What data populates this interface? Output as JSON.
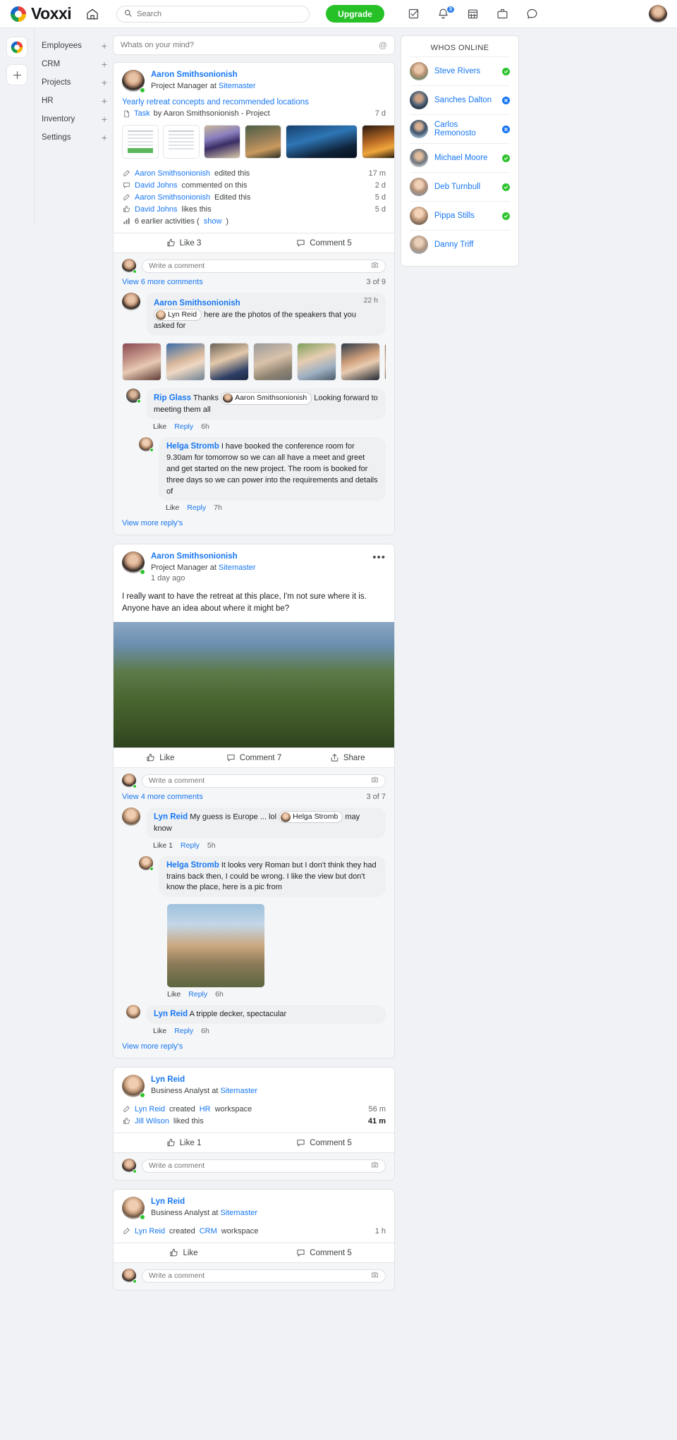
{
  "topbar": {
    "brand": "Voxxi",
    "home_icon": "home-icon",
    "search_placeholder": "Search",
    "upgrade_label": "Upgrade",
    "icons": [
      {
        "name": "tasks-icon",
        "glyph": "checkbox"
      },
      {
        "name": "notifications-icon",
        "glyph": "bell",
        "badge": "3"
      },
      {
        "name": "calendar-icon",
        "glyph": "calendar"
      },
      {
        "name": "briefcase-icon",
        "glyph": "briefcase"
      },
      {
        "name": "messages-icon",
        "glyph": "chat"
      }
    ],
    "accent_green": "#25c127",
    "accent_blue": "#1877f2"
  },
  "sidebar": {
    "workspace_icon": "voxxi-workspace-icon",
    "add_workspace_label": "+",
    "items": [
      {
        "label": "Employees",
        "add": "+"
      },
      {
        "label": "CRM",
        "add": "+"
      },
      {
        "label": "Projects",
        "add": "+"
      },
      {
        "label": "HR",
        "add": "+"
      },
      {
        "label": "Inventory",
        "add": "+"
      },
      {
        "label": "Settings",
        "add": "+"
      }
    ]
  },
  "composer": {
    "placeholder": "Whats on your mind?",
    "at_symbol": "@"
  },
  "posts": [
    {
      "author": "Aaron Smithsonionish",
      "role_prefix": "Project Manager at ",
      "company": "Sitemaster",
      "title": "Yearly retreat concepts and recommended locations",
      "task_prefix": "Task",
      "task_by": "by Aaron Smithsonionish - Project",
      "task_time": "7 d",
      "attachments": [
        {
          "name": "document-thumbnail-1",
          "kind": "doc-green"
        },
        {
          "name": "document-thumbnail-2",
          "kind": "doc"
        },
        {
          "name": "photo-cat-mask",
          "kind": "img-cat"
        },
        {
          "name": "photo-elephant",
          "kind": "img-eleph"
        },
        {
          "name": "photo-lake-night",
          "kind": "img-lake"
        },
        {
          "name": "photo-city-lights",
          "kind": "img-city"
        }
      ],
      "activities": [
        {
          "icon": "edit-icon",
          "actor": "Aaron Smithsonionish",
          "text": " edited this",
          "time": "17 m"
        },
        {
          "icon": "comment-icon",
          "actor": "David Johns",
          "text": " commented on this",
          "time": "2 d"
        },
        {
          "icon": "edit-icon",
          "actor": "Aaron Smithsonionish",
          "text": " Edited this",
          "time": "5 d"
        },
        {
          "icon": "thumbsup-icon",
          "actor": "David Johns",
          "text": " likes this",
          "time": "5 d"
        }
      ],
      "earlier": {
        "icon": "chart-icon",
        "text": "6 earlier activities (",
        "link": "show",
        "close": ")"
      },
      "bar": {
        "like": "Like 3",
        "comment": "Comment 5"
      },
      "comment_placeholder": "Write a comment",
      "view_more": "View 6 more comments",
      "count": "3 of 9",
      "comments": [
        {
          "author": "Aaron Smithsonionish",
          "mention": "Lyn Reid",
          "text": " here are the photos of the speakers that you asked for",
          "time": "22 h",
          "speakers": [
            "speaker-photo-1",
            "speaker-photo-2",
            "speaker-photo-3",
            "speaker-photo-4",
            "speaker-photo-5",
            "speaker-photo-6",
            "speaker-photo-7"
          ]
        },
        {
          "author": "Rip Glass",
          "text_before": " Thanks ",
          "mention": "Aaron Smithsonionish",
          "text_after": " Looking forward to meeting them all",
          "like": "Like",
          "reply": "Reply",
          "time": "6h"
        },
        {
          "author": "Helga Stromb",
          "text": " I have booked the conference room for 9.30am for tomorrow so we can all have a meet and greet and get started on the new project. The room is booked for three days so we can power into the requirements and details of",
          "like": "Like",
          "reply": "Reply",
          "time": "7h"
        }
      ],
      "view_more_replies": "View more reply's"
    },
    {
      "author": "Aaron Smithsonionish",
      "role_prefix": "Project Manager at ",
      "company": "Sitemaster",
      "time": "1 day ago",
      "menu": "•••",
      "body": "I really want to have the retreat at this place, I'm not sure where it is. Anyone have an idea about where it might be?",
      "hero_image": "photo-glenfinnan-valley",
      "bar": {
        "like": "Like",
        "comment": "Comment 7",
        "share": "Share"
      },
      "comment_placeholder": "Write a comment",
      "view_more": "View 4 more comments",
      "count": "3 of 7",
      "comments": [
        {
          "author": "Lyn Reid",
          "text_before": " My guess is Europe ... lol ",
          "mention": "Helga Stromb",
          "text_after": " may know",
          "like": "Like 1",
          "reply": "Reply",
          "time": "5h"
        },
        {
          "author": "Helga Stromb",
          "text": " It looks very Roman but I don't think they had trains back then, I could be wrong. I like the view but don't know the place, here is a pic from",
          "image": "photo-roman-aqueduct",
          "like": "Like",
          "reply": "Reply",
          "time": "6h"
        },
        {
          "author": "Lyn Reid",
          "text": " A tripple decker, spectacular",
          "like": "Like",
          "reply": "Reply",
          "time": "6h"
        }
      ],
      "view_more_replies": "View more reply's"
    },
    {
      "author": "Lyn Reid",
      "role_prefix": "Business Analyst at ",
      "company": "Sitemaster",
      "activities": [
        {
          "icon": "edit-icon",
          "actor": "Lyn Reid",
          "text_mid": " created ",
          "workspace": "HR",
          "text_end": " workspace",
          "time": "56 m"
        },
        {
          "icon": "thumbsup-icon",
          "actor": "Jill Wilson",
          "text": " liked this",
          "time": "41 m",
          "bold_time": true
        }
      ],
      "bar": {
        "like": "Like 1",
        "comment": "Comment 5"
      },
      "comment_placeholder": "Write a comment"
    },
    {
      "author": "Lyn Reid",
      "role_prefix": "Business Analyst at ",
      "company": "Sitemaster",
      "activities": [
        {
          "icon": "edit-icon",
          "actor": "Lyn Reid",
          "text_mid": " created ",
          "workspace": "CRM",
          "text_end": " workspace",
          "time": "1 h"
        }
      ],
      "bar": {
        "like": "Like",
        "comment": "Comment 5"
      },
      "comment_placeholder": "Write a comment"
    }
  ],
  "whos_online": {
    "title": "WHOS ONLINE",
    "people": [
      {
        "name": "Steve Rivers",
        "status": "online"
      },
      {
        "name": "Sanches Dalton",
        "status": "offline"
      },
      {
        "name": "Carlos Remonosto",
        "status": "offline"
      },
      {
        "name": "Michael Moore",
        "status": "online"
      },
      {
        "name": "Deb Turnbull",
        "status": "online"
      },
      {
        "name": "Pippa Stills",
        "status": "online"
      },
      {
        "name": "Danny Triff",
        "status": "none"
      }
    ]
  }
}
